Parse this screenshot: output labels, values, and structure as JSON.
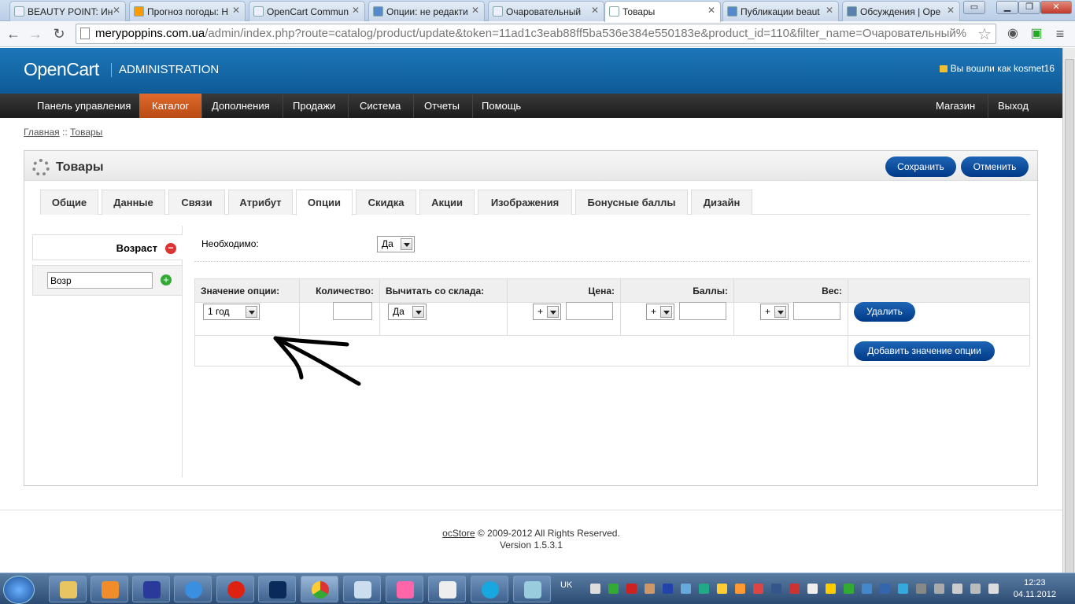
{
  "browser": {
    "tabs": [
      {
        "title": "BEAUTY POINT: Ин",
        "active": false
      },
      {
        "title": "Прогноз погоды: Н",
        "active": false
      },
      {
        "title": "OpenCart Commun",
        "active": false
      },
      {
        "title": "Опции: не редакти",
        "active": false
      },
      {
        "title": "Очаровательный",
        "active": false
      },
      {
        "title": "Товары",
        "active": true
      },
      {
        "title": "Публикации beaut",
        "active": false
      },
      {
        "title": "Обсуждения | Оре",
        "active": false
      }
    ],
    "url_domain": "merypoppins.com.ua",
    "url_path": "/admin/index.php?route=catalog/product/update&token=11ad1c3eab88ff5ba536e384e550183e&product_id=110&filter_name=Очаровательный%"
  },
  "header": {
    "logo": "OpenCart",
    "subtitle": "ADMINISTRATION",
    "user_text": "Вы вошли как kosmet16"
  },
  "menu": {
    "items": [
      "Панель управления",
      "Каталог",
      "Дополнения",
      "Продажи",
      "Система",
      "Отчеты",
      "Помощь"
    ],
    "active": "Каталог",
    "right_items": [
      "Магазин",
      "Выход"
    ]
  },
  "breadcrumb": {
    "home": "Главная",
    "sep": " :: ",
    "current": "Товары"
  },
  "box": {
    "title": "Товары",
    "save_label": "Сохранить",
    "cancel_label": "Отменить"
  },
  "tabs": [
    "Общие",
    "Данные",
    "Связи",
    "Атрибут",
    "Опции",
    "Скидка",
    "Акции",
    "Изображения",
    "Бонусные баллы",
    "Дизайн"
  ],
  "active_tab": "Опции",
  "options_sidebar": {
    "option_name": "Возраст",
    "input_value": "Возр"
  },
  "option_form": {
    "required_label": "Необходимо:",
    "required_value": "Да",
    "columns": [
      "Значение опции:",
      "Количество:",
      "Вычитать со склада:",
      "Цена:",
      "Баллы:",
      "Вес:"
    ],
    "row": {
      "option_value": "1 год",
      "quantity": "",
      "subtract": "Да",
      "price_prefix": "+",
      "price": "",
      "points_prefix": "+",
      "points": "",
      "weight_prefix": "+",
      "weight": ""
    },
    "remove_label": "Удалить",
    "add_value_label": "Добавить значение опции"
  },
  "footer": {
    "brand": "ocStore",
    "copyright": "© 2009-2012 All Rights Reserved.",
    "version": "Version 1.5.3.1"
  },
  "taskbar": {
    "lang": "UK",
    "time": "12:23",
    "date": "04.11.2012"
  }
}
